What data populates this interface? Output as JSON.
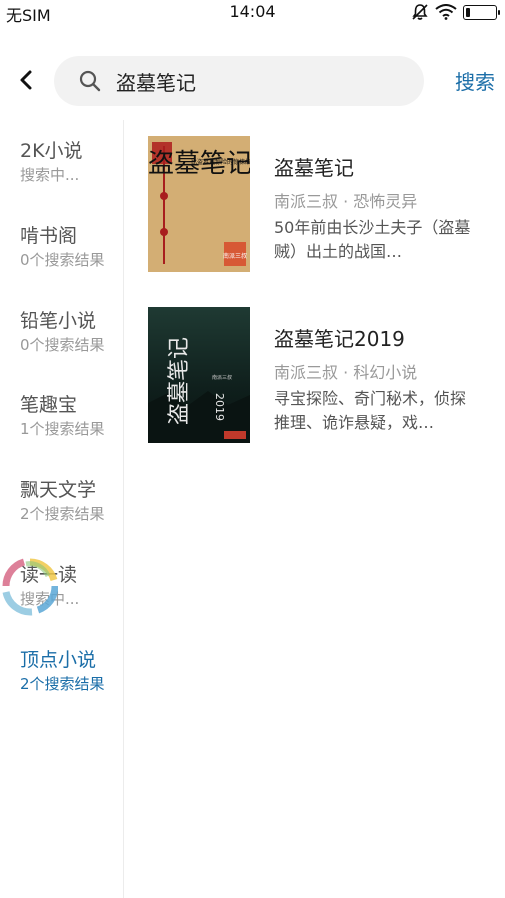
{
  "status_bar": {
    "carrier": "无SIM",
    "time": "14:04",
    "battery_level": 0.15
  },
  "search": {
    "query": "盗墓笔记",
    "action_label": "搜索",
    "icons": {
      "back": "chevron-left-icon",
      "search": "search-icon"
    }
  },
  "sources": [
    {
      "name": "2K小说",
      "status": "搜索中..."
    },
    {
      "name": "啃书阁",
      "status": "0个搜索结果"
    },
    {
      "name": "铅笔小说",
      "status": "0个搜索结果"
    },
    {
      "name": "笔趣宝",
      "status": "1个搜索结果"
    },
    {
      "name": "飘天文学",
      "status": "2个搜索结果"
    },
    {
      "name": "读一读",
      "status": "搜索中..."
    },
    {
      "name": "顶点小说",
      "status": "2个搜索结果"
    }
  ],
  "active_source_index": 6,
  "accent_color": "#1b6ea8",
  "results": [
    {
      "title": "盗墓笔记",
      "meta": "南派三叔 · 恐怖灵异",
      "description": "50年前由长沙土夫子（盗墓贼）出土的战国…",
      "cover": {
        "title_text": "盗墓笔记",
        "tagline": "比盗墓更惊险的惊悚故事来了！",
        "author": "南派三叔"
      }
    },
    {
      "title": "盗墓笔记2019",
      "meta": "南派三叔 · 科幻小说",
      "description": "寻宝探险、奇门秘术，侦探推理、诡诈悬疑，戏…",
      "cover": {
        "title_text": "盗墓笔记",
        "year": "2019",
        "author": "南派三叔"
      }
    }
  ]
}
